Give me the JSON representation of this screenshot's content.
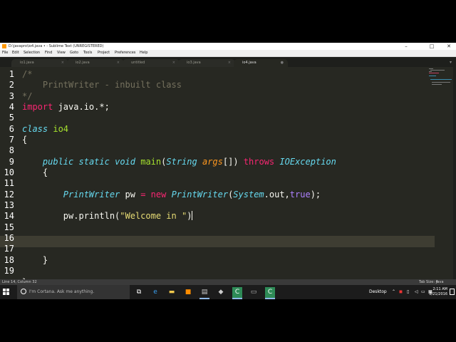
{
  "window": {
    "title": "D:\\javapro\\io4.java • - Sublime Text (UNREGISTERED)",
    "minimize": "–",
    "maximize": "□",
    "close": "✕"
  },
  "menu": [
    "File",
    "Edit",
    "Selection",
    "Find",
    "View",
    "Goto",
    "Tools",
    "Project",
    "Preferences",
    "Help"
  ],
  "tabs": [
    {
      "label": "io1.java",
      "close": "×"
    },
    {
      "label": "io2.java",
      "close": "×"
    },
    {
      "label": "untitled",
      "close": "×"
    },
    {
      "label": "io3.java",
      "close": "×"
    },
    {
      "label": "io4.java",
      "close": "●"
    }
  ],
  "active_tab": 4,
  "tabs_dropdown": "▾",
  "editor": {
    "line_numbers": [
      "1",
      "2",
      "3",
      "4",
      "5",
      "6",
      "7",
      "8",
      "9",
      "10",
      "11",
      "12",
      "13",
      "14",
      "15",
      "16",
      "17",
      "18",
      "19"
    ],
    "current_line": 14,
    "code": {
      "l1": "/*",
      "l2": "    PrintWriter - inbuilt class",
      "l3": "*/",
      "l4_kw": "import",
      "l4_rest": " java.io.*;",
      "l6_kw": "class",
      "l6_name": " io4",
      "l7": "{",
      "l9_indent": "    ",
      "l9_public": "public",
      "l9_static": "static",
      "l9_void": "void",
      "l9_main": "main",
      "l9_open": "(",
      "l9_string": "String",
      "l9_args": "args",
      "l9_close": "[])",
      "l9_throws": "throws",
      "l9_exc": "IOException",
      "l10": "    {",
      "l12_indent": "        ",
      "l12_pw_type": "PrintWriter",
      "l12_pw": " pw ",
      "l12_eq": "=",
      "l12_new": "new",
      "l12_ctor": "PrintWriter",
      "l12_open": "(",
      "l12_system": "System",
      "l12_out": ".out,",
      "l12_true": "true",
      "l12_end": ");",
      "l14_indent": "        ",
      "l14_call": "pw.println(",
      "l14_str": "\"Welcome in \"",
      "l14_end": ")",
      "l17": "    }",
      "l19": "}"
    }
  },
  "status": {
    "position": "Line 14, Column 32",
    "tab_size": "Tab Size: 4",
    "syntax": "Java"
  },
  "taskbar": {
    "search_placeholder": "I'm Cortana. Ask me anything.",
    "desktop_label": "Desktop",
    "time": "2:11 AM",
    "date": "8/21/2016"
  },
  "colors": {
    "background": "#272822",
    "comment": "#75715e",
    "keyword": "#f92672",
    "type": "#66d9ef",
    "string": "#e6db74",
    "function": "#a6e22e",
    "parameter": "#fd971f",
    "constant": "#ae81ff"
  }
}
